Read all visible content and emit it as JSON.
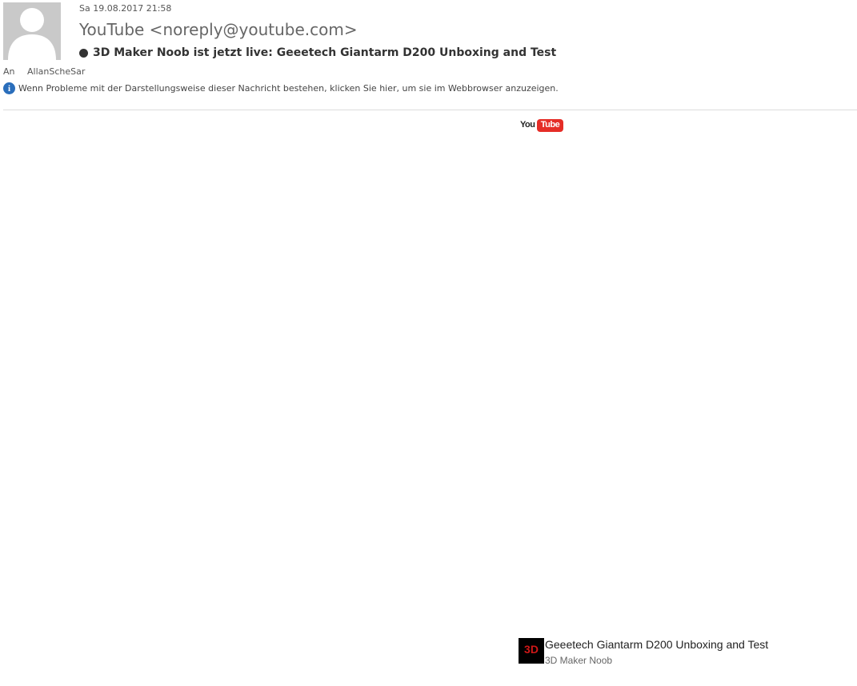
{
  "header": {
    "date": "Sa 19.08.2017 21:58",
    "sender": "YouTube <noreply@youtube.com>",
    "subject": "3D Maker Noob ist jetzt live: Geeetech Giantarm D200 Unboxing and Test"
  },
  "recipient": {
    "label": "An",
    "name": "AllanScheSar"
  },
  "info_bar": {
    "text": "Wenn Probleme mit der Darstellungsweise dieser Nachricht bestehen, klicken Sie hier, um sie im Webbrowser anzuzeigen."
  },
  "body": {
    "logo_you": "You",
    "logo_tube": "Tube",
    "video_title": "Geeetech Giantarm D200 Unboxing and Test",
    "channel_name": "3D Maker Noob",
    "thumb_text": "3D"
  },
  "colors": {
    "youtube_red": "#e52d27",
    "info_blue": "#2a6ebb",
    "avatar_grey": "#c9c9c9"
  },
  "icons": {
    "avatar": "person-silhouette-icon",
    "info": "info-icon",
    "live": "live-dot-icon"
  }
}
